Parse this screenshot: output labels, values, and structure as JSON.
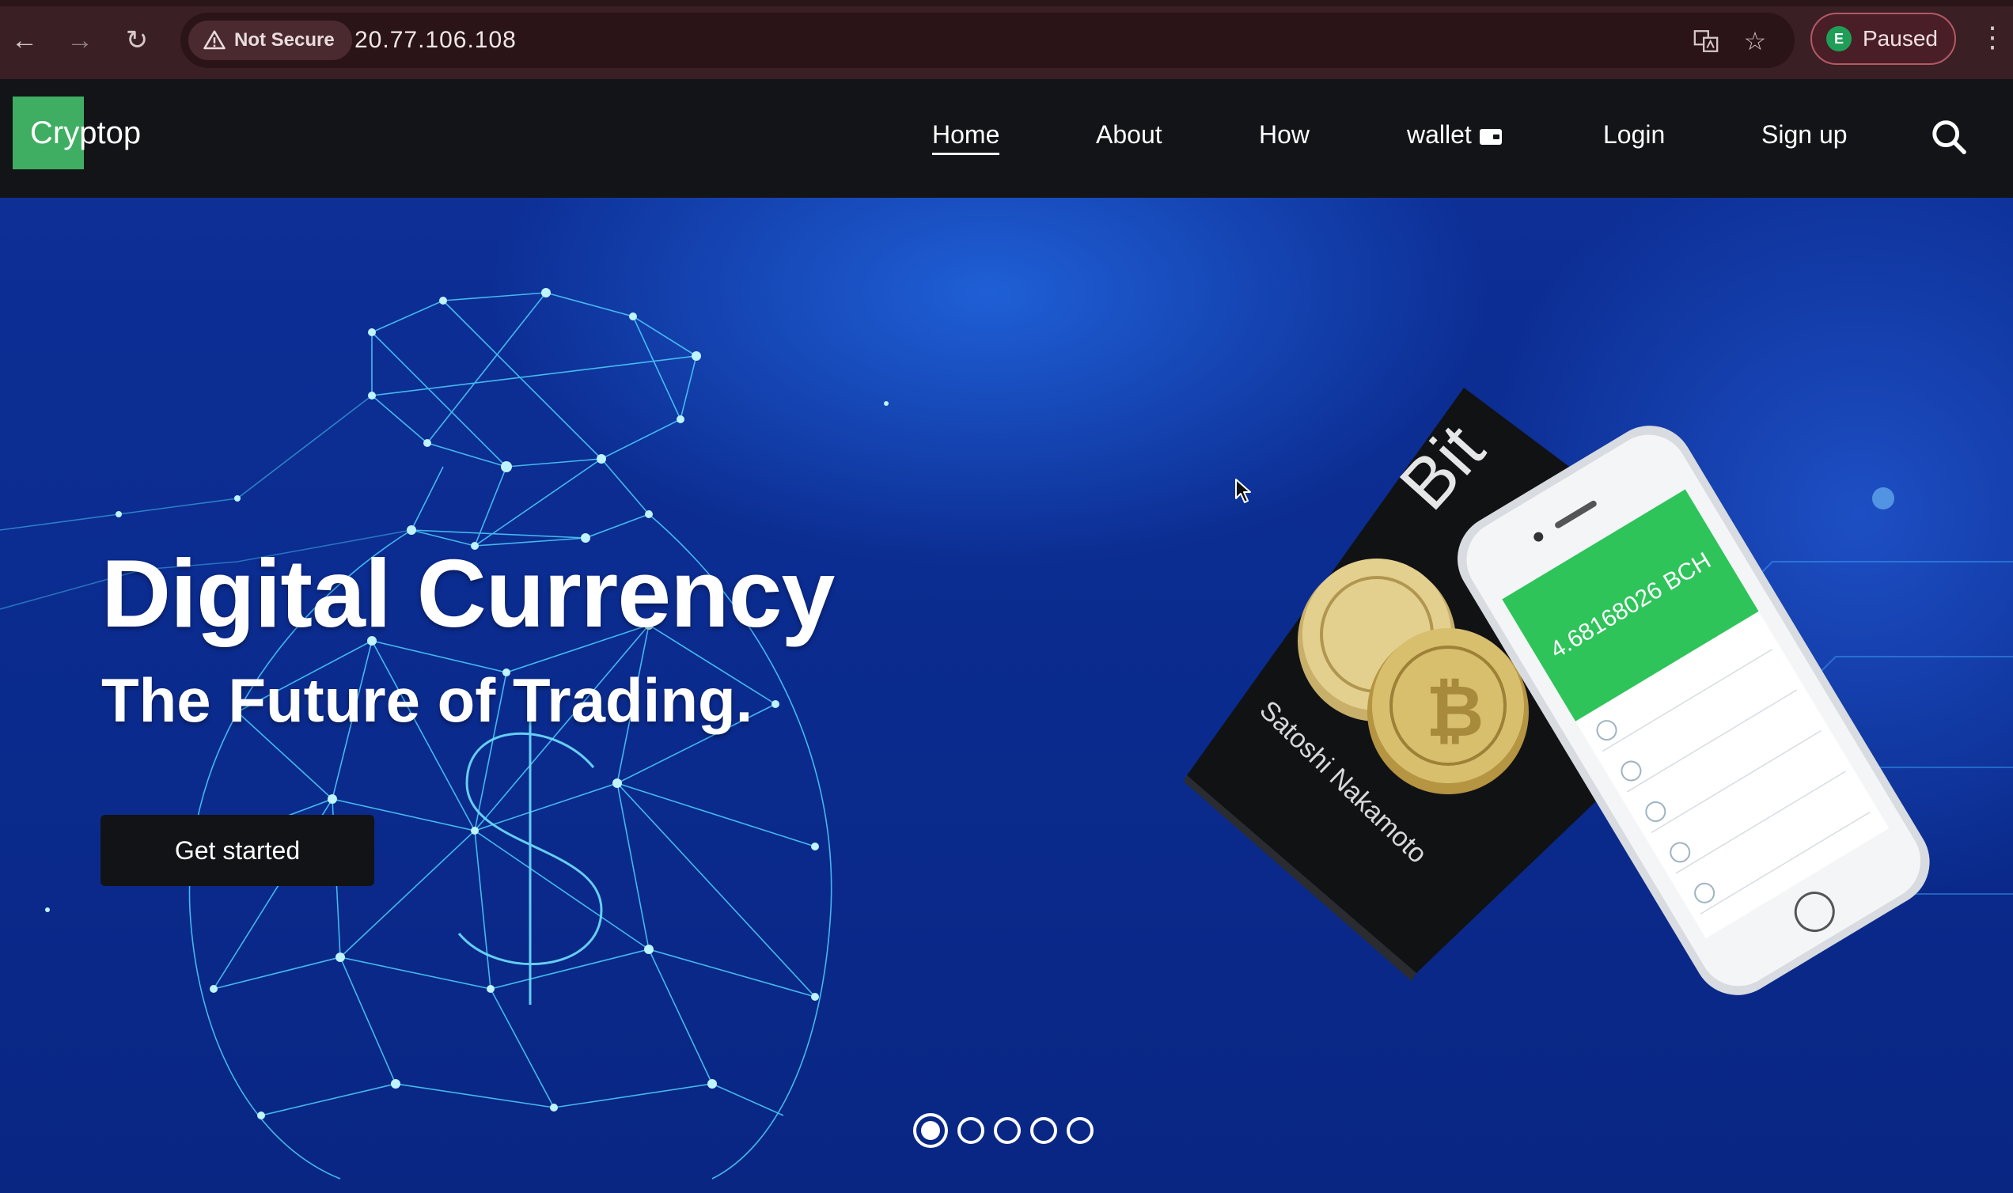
{
  "browser": {
    "security_label": "Not Secure",
    "url": "20.77.106.108",
    "profile_initial": "E",
    "profile_status": "Paused"
  },
  "site": {
    "logo": "Cryptop",
    "nav": [
      {
        "label": "Home",
        "active": true
      },
      {
        "label": "About"
      },
      {
        "label": "How"
      },
      {
        "label": "wallet"
      },
      {
        "label": "Login"
      },
      {
        "label": "Sign up"
      }
    ]
  },
  "hero": {
    "title": "Digital Currency",
    "subtitle": "The Future of Trading.",
    "cta": "Get started",
    "phone_balance": "4.68168026 BCH",
    "book_spine": "Bit",
    "book_author": "Satoshi Nakamoto",
    "carousel_count": 5,
    "carousel_active": 1
  },
  "colors": {
    "brand_green": "#3fae63",
    "hero_blue": "#0b2a8a",
    "navbar": "#131418",
    "chrome": "#3a1f24"
  }
}
